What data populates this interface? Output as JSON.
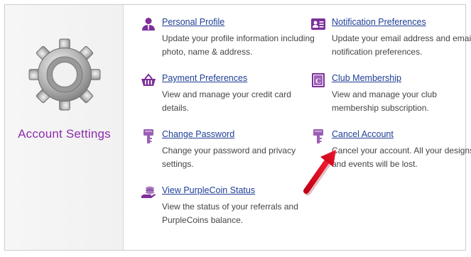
{
  "sidebar": {
    "title": "Account Settings",
    "icon": "gear-icon"
  },
  "links": {
    "personal_profile": {
      "label": "Personal Profile",
      "description": "Update your profile information including photo, name & address.",
      "icon": "person-icon"
    },
    "notification_preferences": {
      "label": "Notification Preferences",
      "description": "Update your email address and email notification preferences.",
      "icon": "id-card-icon"
    },
    "payment_preferences": {
      "label": "Payment Preferences",
      "description": "View and manage your credit card details.",
      "icon": "basket-icon"
    },
    "club_membership": {
      "label": "Club Membership",
      "description": "View and manage your club membership subscription.",
      "icon": "club-c-icon"
    },
    "change_password": {
      "label": "Change Password",
      "description": "Change your password and privacy settings.",
      "icon": "key-icon"
    },
    "cancel_account": {
      "label": "Cancel Account",
      "description": "Cancel your account. All your designs and events will be lost.",
      "icon": "key-icon"
    },
    "purplecoin_status": {
      "label": "View PurpleCoin Status",
      "description": "View the status of your referrals and PurpleCoins balance.",
      "icon": "coins-icon"
    }
  },
  "colors": {
    "accent": "#8e2cab",
    "link": "#1f3f96",
    "arrow": "#e3001b"
  }
}
